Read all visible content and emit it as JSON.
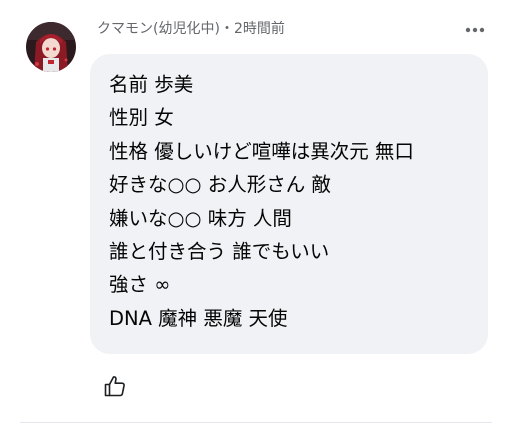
{
  "comment": {
    "author": "クマモン(幼児化中)",
    "separator": "・",
    "timestamp": "2時間前",
    "lines": [
      "名前 歩美",
      "性別 女",
      "性格 優しいけど喧嘩は異次元 無口",
      "好きな○○ お人形さん 敵",
      "嫌いな○○ 味方 人間",
      "誰と付き合う 誰でもいい",
      "強さ ∞",
      "DNA 魔神 悪魔 天使"
    ]
  },
  "icons": {
    "avatar": "avatar-anime-girl",
    "more": "more-dots-icon",
    "like": "thumbs-up-icon"
  },
  "colors": {
    "bubble": "#f0f2f5",
    "meta_text": "#65676b",
    "body_text": "#050505",
    "avatar_bg": "#2a1a1e",
    "avatar_hair": "#8b1a24"
  }
}
